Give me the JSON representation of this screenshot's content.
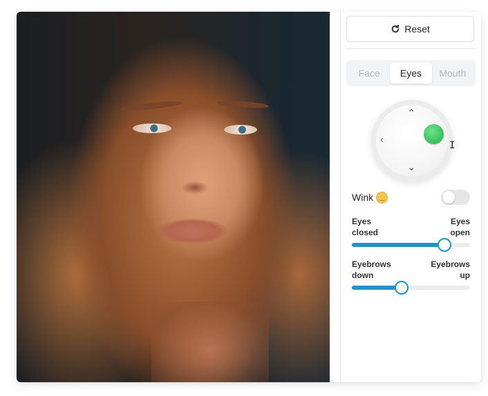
{
  "reset_label": "Reset",
  "tabs": [
    {
      "label": "Face",
      "active": false
    },
    {
      "label": "Eyes",
      "active": true
    },
    {
      "label": "Mouth",
      "active": false
    }
  ],
  "joystick": {
    "up": "^",
    "left": "<",
    "down": "v",
    "handle_color": "#3fc462"
  },
  "wink": {
    "label": "Wink",
    "emoji": "😉",
    "on": false
  },
  "sliders": [
    {
      "left_label": "Eyes closed",
      "left_l1": "Eyes",
      "left_l2": "closed",
      "right_l1": "Eyes",
      "right_l2": "open",
      "value": 0.77
    },
    {
      "left_label": "Eyebrows down",
      "left_l1": "Eyebrows",
      "left_l2": "down",
      "right_l1": "Eyebrows",
      "right_l2": "up",
      "value": 0.41
    }
  ],
  "colors": {
    "accent": "#2094c4",
    "handle": "#3fc462"
  }
}
